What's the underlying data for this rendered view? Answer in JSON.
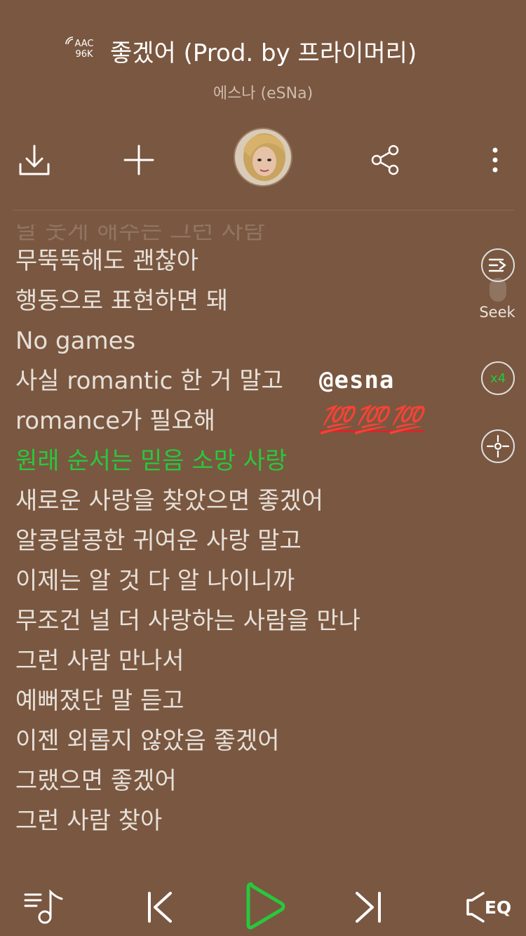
{
  "header": {
    "codec_line1": "AAC",
    "codec_line2": "96K",
    "song_title": "좋겠어 (Prod. by 프라이머리)",
    "artist": "에스나 (eSNa)"
  },
  "toolbar": {
    "download_icon": "download-icon",
    "add_icon": "plus-icon",
    "share_icon": "share-icon",
    "more_icon": "more-vertical-icon"
  },
  "lyrics": {
    "faded_line": "날 웃게 해주는 그런 사람",
    "lines": [
      "무뚝뚝해도 괜찮아",
      "행동으로 표현하면 돼",
      "No games",
      "사실 romantic 한 거 말고",
      "romance가 필요해",
      "원래 순서는 믿음 소망 사랑",
      "새로운 사랑을 찾았으면 좋겠어",
      "알콩달콩한 귀여운 사랑 말고",
      "이제는 알 것 다 알 나이니까",
      "무조건 널 더 사랑하는 사람을 만나",
      "그런 사람 만나서",
      "예뻐졌단 말 듣고",
      "이젠 외롭지 않았음 좋겠어",
      "그랬으면 좋겠어",
      "그런 사람 찾아"
    ],
    "current_index": 5
  },
  "side": {
    "seek_label": "Seek",
    "speed_label": "x4"
  },
  "sticker": {
    "username": "@esna",
    "emoji": "💯💯💯"
  },
  "bottom": {
    "eq_label": "EQ"
  },
  "colors": {
    "background": "#7a5740",
    "accent": "#28c83d",
    "emoji_red": "#d7262b"
  }
}
